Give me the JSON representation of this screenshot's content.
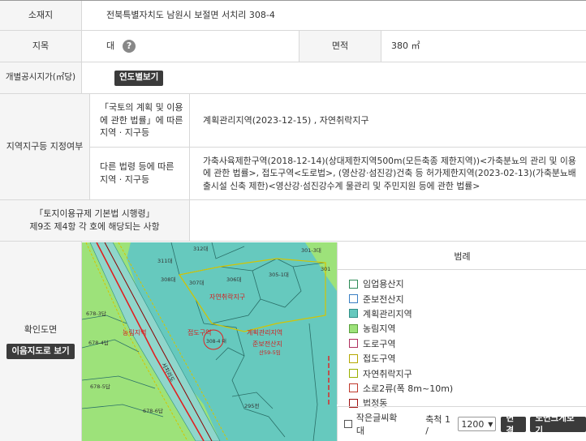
{
  "rows": {
    "location": {
      "label": "소재지",
      "value": "전북특별자치도 남원시 보절면 서치리 308-4"
    },
    "land": {
      "label": "지목",
      "value": "대",
      "area_label": "면적",
      "area_value": "380 ㎡"
    },
    "price": {
      "label": "개별공시지가(㎡당)",
      "button": "연도별보기"
    },
    "zone": {
      "label": "지역지구등 지정여부",
      "national_label": "「국토의 계획 및 이용에 관한 법률」에 따른 지역 · 지구등",
      "national_value": "계획관리지역(2023-12-15) , 자연취락지구",
      "other_label": "다른 법령 등에 따른 지역 · 지구등",
      "other_value": "가축사육제한구역(2018-12-14)(상대제한지역500m(모든축종 제한지역))<가축분뇨의 관리 및 이용에 관한 법률>, 접도구역<도로법>, (영산강·섬진강)건축 등 허가제한지역(2023-02-13)(가축분뇨배출시설 신축 제한)<영산강·섬진강수계 물관리 및 주민지원 등에 관한 법률>"
    },
    "regulation": {
      "label_line1": "「토지이용규제 기본법 시행령」",
      "label_line2": "제9조 제4항 각 호에 해당되는 사항",
      "value": ""
    },
    "map": {
      "label": "확인도면",
      "button": "이음지도로 보기"
    }
  },
  "legend": {
    "title": "범례",
    "items": [
      {
        "label": "임업용산지",
        "color": "#ffffff",
        "border": "#2e8b57"
      },
      {
        "label": "준보전산지",
        "color": "#ffffff",
        "border": "#3a7fc4"
      },
      {
        "label": "계획관리지역",
        "color": "#66c9be",
        "border": "#2f8f87"
      },
      {
        "label": "농림지역",
        "color": "#9de27a",
        "border": "#5aa03c"
      },
      {
        "label": "도로구역",
        "color": "#ffffff",
        "border": "#b03060"
      },
      {
        "label": "접도구역",
        "color": "#ffffff",
        "border": "#b5a800"
      },
      {
        "label": "자연취락지구",
        "color": "#ffffff",
        "border": "#9ab000"
      },
      {
        "label": "소로2류(폭 8m~10m)",
        "color": "#ffffff",
        "border": "#c0392b"
      },
      {
        "label": "법정동",
        "color": "#ffffff",
        "border": "#a01010"
      }
    ]
  },
  "controls": {
    "small_text_label": "작은글씨확대",
    "scale_label": "축척 1 /",
    "scale_value": "1200",
    "change_button": "변경",
    "enlarge_button": "도면크게보기"
  },
  "map_labels": {
    "parcels": [
      "312대",
      "311대",
      "308대",
      "307대",
      "306대",
      "305-1대",
      "301-3대",
      "301",
      "678-3답",
      "678-4답",
      "678-5답",
      "678-6답",
      "295전"
    ],
    "selected_parcel": "308-4 대",
    "zones": [
      "자연취락지구",
      "농림지역",
      "접도구역",
      "계획관리지역",
      "준보전산지",
      "산59-5임"
    ],
    "road": "서치리도"
  }
}
